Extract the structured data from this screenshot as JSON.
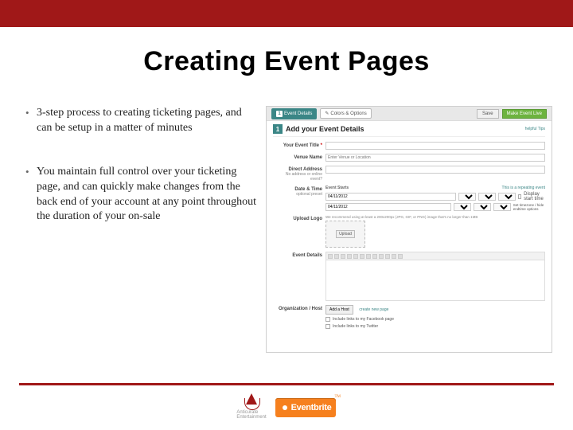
{
  "title": "Creating Event Pages",
  "bullets": {
    "b1": "3-step process to creating ticketing pages, and can be setup in a matter of minutes",
    "b2": "You maintain full control over your ticketing page, and can quickly make changes from the back end of your account at any point throughout the duration of your on-sale"
  },
  "screenshot": {
    "tabs": {
      "t1_num": "1",
      "t1": "Event Details",
      "t2": "Colors & Options"
    },
    "save": "Save",
    "live": "Make Event Live",
    "step_num": "1",
    "step_title": "Add your Event Details",
    "tips": "helpful Tips",
    "labels": {
      "title": "Your Event Title",
      "req": "*",
      "venue": "Venue Name",
      "venue_ph": "Enter Venue or Location",
      "address": "Direct Address",
      "address_sub": "No address or online event?",
      "date": "Date & Time",
      "date_sub": "optional preset",
      "date_from": "04/11/2012",
      "date_to": "04/11/2012",
      "repeat": "This is a repeating event",
      "display_note": "Display start time",
      "tz_note": "Set timezone / hide endtime options",
      "logo": "Upload Logo",
      "logo_note": "We recommend using at least a 200x200px (JPG, GIF, or PNG) image that's no larger than 1MB",
      "upload_btn": "Upload",
      "details": "Event Details",
      "host": "Organization / Host",
      "addhost": "Add a Host",
      "newpage": "create new page",
      "social1": "Include links to my Facebook page",
      "social2": "Include links to my Twitter"
    }
  },
  "footer": {
    "anti": "Anticurate Entertainment",
    "eb": "Eventbrite",
    "tm": "TM"
  }
}
